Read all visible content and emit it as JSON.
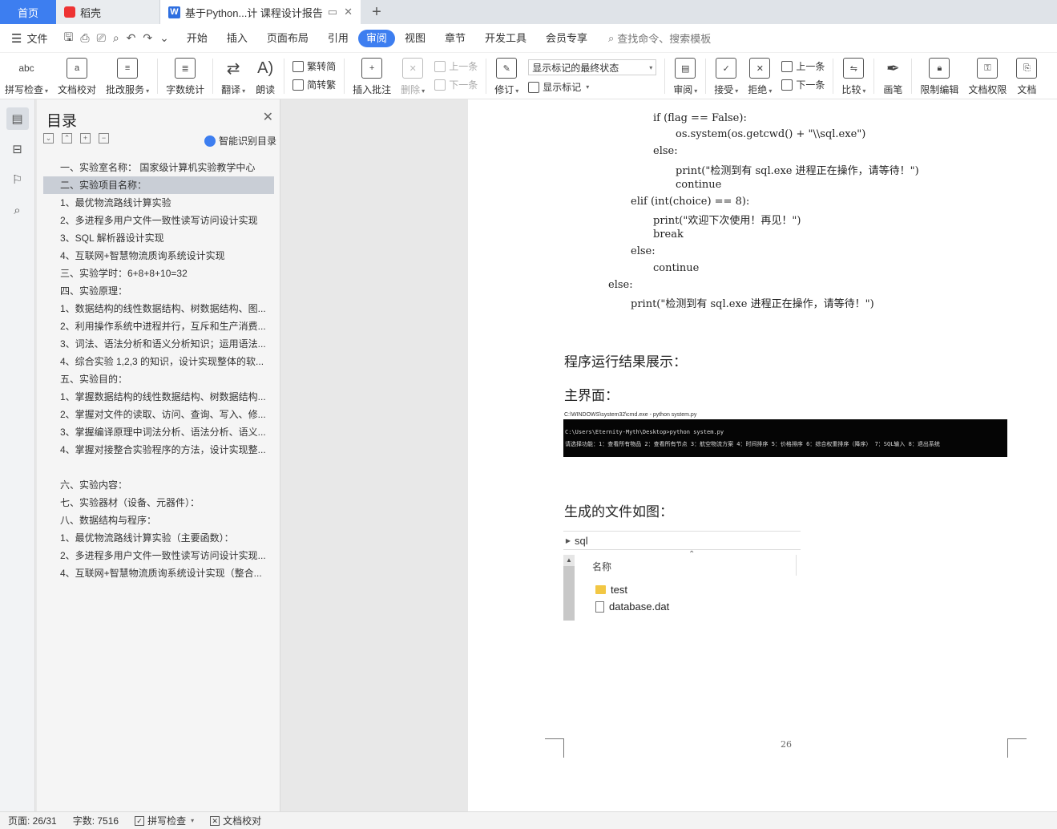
{
  "tabs": {
    "home": "首页",
    "daoke": "稻壳",
    "doc": "基于Python...计 课程设计报告",
    "add": "+"
  },
  "menubar": {
    "file": "文件",
    "items": [
      "开始",
      "插入",
      "页面布局",
      "引用",
      "审阅",
      "视图",
      "章节",
      "开发工具",
      "会员专享"
    ],
    "active": "审阅",
    "search": "查找命令、搜索模板"
  },
  "ribbon": {
    "spell": "拼写检查",
    "proof": "文档校对",
    "batch": "批改服务",
    "wordcount": "字数统计",
    "translate": "翻译",
    "read": "朗读",
    "to_trad": "繁转简",
    "to_simp": "简转繁",
    "insert_comment": "插入批注",
    "delete": "删除",
    "prev_comment": "上一条",
    "next_comment": "下一条",
    "revise": "修订",
    "markup_state": "显示标记的最终状态",
    "show_markup": "显示标记",
    "review": "审阅",
    "accept": "接受",
    "reject": "拒绝",
    "prev": "上一条",
    "next": "下一条",
    "compare": "比较",
    "pen": "画笔",
    "restrict": "限制编辑",
    "permission": "文档权限",
    "more": "文档"
  },
  "toc": {
    "title": "目录",
    "smart": "智能识别目录",
    "items": [
      "一、实验室名称：  国家级计算机实验教学中心",
      "二、实验项目名称：",
      "1、最优物流路线计算实验",
      "2、多进程多用户文件一致性读写访问设计实现",
      "3、SQL 解析器设计实现",
      "4、互联网+智慧物流质询系统设计实现",
      "三、实验学时：6+8+8+10=32",
      "四、实验原理：",
      "1、数据结构的线性数据结构、树数据结构、图...",
      "2、利用操作系统中进程并行，互斥和生产消费...",
      "3、词法、语法分析和语义分析知识；运用语法...",
      "4、综合实验 1,2,3 的知识，设计实现整体的软...",
      "五、实验目的：",
      "1、掌握数据结构的线性数据结构、树数据结构...",
      "2、掌握对文件的读取、访问、查询、写入、修...",
      "3、掌握编译原理中词法分析、语法分析、语义...",
      "4、掌握对接整合实验程序的方法，设计实现整...",
      "",
      "六、实验内容：",
      "七、实验器材（设备、元器件）：",
      "八、数据结构与程序：",
      "1、最优物流路线计算实验（主要函数）：",
      "2、多进程多用户文件一致性读写访问设计实现...",
      "4、互联网+智慧物流质询系统设计实现（整合..."
    ],
    "selected_index": 1
  },
  "doc": {
    "code_lines": [
      "if (flag == False):",
      "os.system(os.getcwd() + \"\\\\sql.exe\")",
      "else:",
      "print(\"检测到有 sql.exe 进程正在操作，请等待！\")",
      "continue",
      "elif (int(choice) == 8):",
      "print(\"欢迎下次使用！再见！\")",
      "break",
      "else:",
      "continue",
      "else:",
      "print(\"检测到有 sql.exe 进程正在操作，请等待！\")"
    ],
    "heading_result": "程序运行结果展示：",
    "heading_main": "主界面：",
    "cmd_title": "C:\\WINDOWS\\system32\\cmd.exe - python  system.py",
    "cmd_line1": "C:\\Users\\Eternity-Myth\\Desktop>python system.py",
    "cmd_line2": "请选择功能：1：查看所有物品 2：查看所有节点 3：航空物流方案 4：时间排序 5：价格排序 6：综合权重排序（降序） 7：SQL输入 8：退出系统",
    "heading_files": "生成的文件如图：",
    "explorer_path": "sql",
    "explorer_col": "名称",
    "files": [
      "test",
      "database.dat"
    ],
    "page_number": "26"
  },
  "status": {
    "page": "页面: 26/31",
    "words": "字数: 7516",
    "spell": "拼写检查",
    "proof": "文档校对"
  }
}
